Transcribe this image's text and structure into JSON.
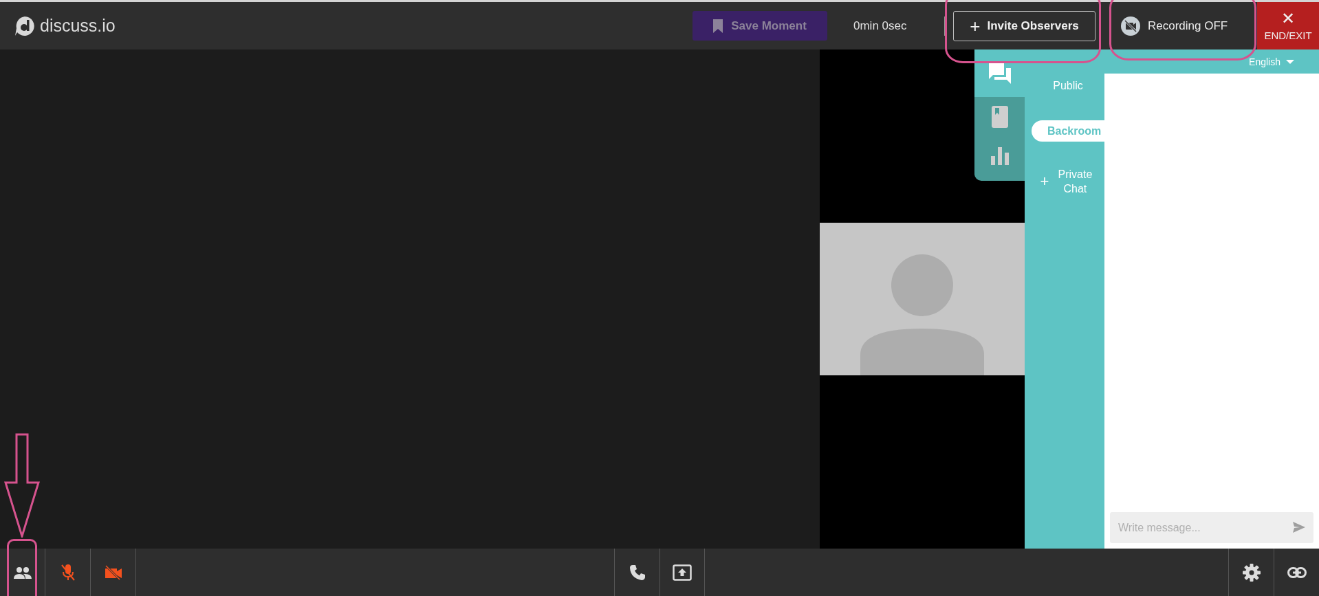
{
  "header": {
    "logo": "discuss.io",
    "save_moment": {
      "label": "Save Moment",
      "disabled": true
    },
    "timer": "0min 0sec",
    "invite": {
      "icon": "+",
      "label": "Invite Observers",
      "highlighted": true
    },
    "recording": {
      "label": "Recording OFF",
      "on": false,
      "highlighted": true
    },
    "end_exit": {
      "icon": "✕",
      "label": "END/EXIT"
    }
  },
  "side_rail": [
    {
      "kind": "chat",
      "selected": true
    },
    {
      "kind": "notes",
      "selected": false
    },
    {
      "kind": "polls",
      "selected": false
    }
  ],
  "chat": {
    "language": "English",
    "tabs": [
      {
        "label": "Public",
        "selected": false
      },
      {
        "label": "Backroom",
        "selected": true
      },
      {
        "icon": "+",
        "label": "Private Chat",
        "selected": false
      }
    ],
    "message": {
      "placeholder": "Write message..."
    }
  },
  "toolbar": {
    "left": [
      {
        "kind": "participants",
        "highlighted": true
      },
      {
        "kind": "mic",
        "on": false
      },
      {
        "kind": "camera",
        "on": false
      }
    ],
    "center": [
      {
        "kind": "phone"
      },
      {
        "kind": "share_screen"
      }
    ],
    "right": [
      {
        "kind": "settings"
      },
      {
        "kind": "link"
      }
    ]
  }
}
